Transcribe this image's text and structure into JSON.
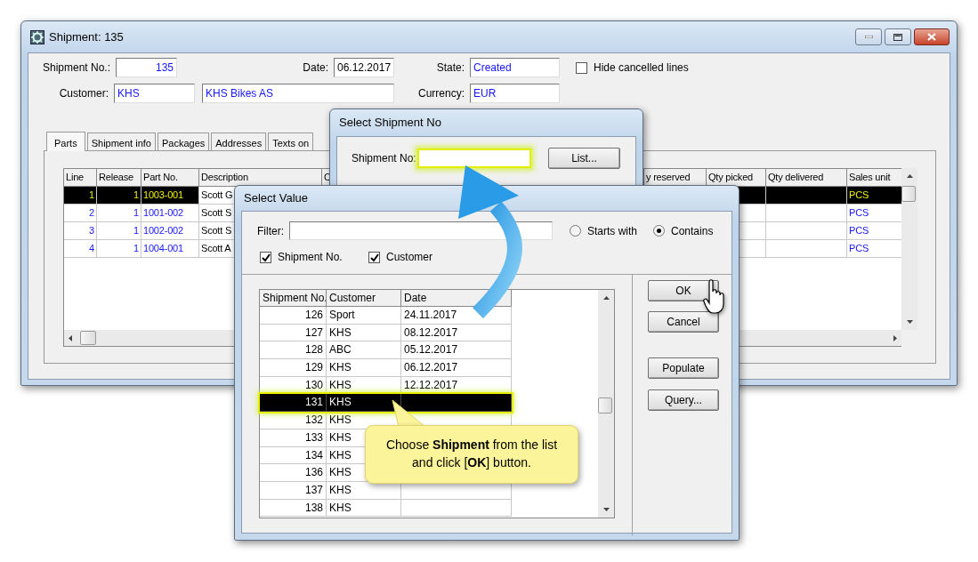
{
  "main_window": {
    "title": "Shipment: 135",
    "header": {
      "shipment_no": {
        "label": "Shipment No.:",
        "value": "135"
      },
      "date": {
        "label": "Date:",
        "value": "06.12.2017"
      },
      "state": {
        "label": "State:",
        "value": "Created"
      },
      "hide_cancelled": {
        "label": "Hide cancelled lines",
        "checked": false
      },
      "customer": {
        "label": "Customer:",
        "code": "KHS",
        "name": "KHS Bikes AS"
      },
      "currency": {
        "label": "Currency:",
        "value": "EUR"
      }
    },
    "tabs": [
      {
        "label": "Parts",
        "selected": true
      },
      {
        "label": "Shipment info",
        "selected": false
      },
      {
        "label": "Packages",
        "selected": false
      },
      {
        "label": "Addresses",
        "selected": false
      },
      {
        "label": "Texts on",
        "selected": false
      }
    ],
    "table": {
      "columns": [
        "Line",
        "Release",
        "Part No.",
        "Description",
        "C",
        "y reserved",
        "Qty picked",
        "Qty delivered",
        "Sales unit"
      ],
      "rows": [
        {
          "line": "1",
          "release": "1",
          "part_no": "1003-001",
          "description": "Scott G",
          "sales_unit": "PCS",
          "selected": true
        },
        {
          "line": "2",
          "release": "1",
          "part_no": "1001-002",
          "description": "Scott S",
          "sales_unit": "PCS",
          "selected": false
        },
        {
          "line": "3",
          "release": "1",
          "part_no": "1002-002",
          "description": "Scott S",
          "sales_unit": "PCS",
          "selected": false
        },
        {
          "line": "4",
          "release": "1",
          "part_no": "1004-001",
          "description": "Scott A",
          "sales_unit": "PCS",
          "selected": false
        }
      ]
    }
  },
  "shipment_dialog": {
    "title": "Select Shipment No",
    "field_label": "Shipment No:",
    "list_button": "List..."
  },
  "select_dialog": {
    "title": "Select Value",
    "filter_label": "Filter:",
    "match_options": [
      {
        "label": "Starts with",
        "selected": false
      },
      {
        "label": "Contains",
        "selected": true
      }
    ],
    "search_in": [
      {
        "label": "Shipment No.",
        "checked": true
      },
      {
        "label": "Customer",
        "checked": true
      }
    ],
    "list": {
      "columns": [
        "Shipment No.",
        "Customer",
        "Date"
      ],
      "rows": [
        {
          "shipment_no": "126",
          "customer": "Sport",
          "date": "24.11.2017",
          "selected": false
        },
        {
          "shipment_no": "127",
          "customer": "KHS",
          "date": "08.12.2017",
          "selected": false
        },
        {
          "shipment_no": "128",
          "customer": "ABC",
          "date": "05.12.2017",
          "selected": false
        },
        {
          "shipment_no": "129",
          "customer": "KHS",
          "date": "06.12.2017",
          "selected": false
        },
        {
          "shipment_no": "130",
          "customer": "KHS",
          "date": "12.12.2017",
          "selected": false
        },
        {
          "shipment_no": "131",
          "customer": "KHS",
          "selected": true
        },
        {
          "shipment_no": "132",
          "customer": "KHS",
          "selected": false
        },
        {
          "shipment_no": "133",
          "customer": "KHS",
          "selected": false
        },
        {
          "shipment_no": "134",
          "customer": "KHS",
          "selected": false
        },
        {
          "shipment_no": "136",
          "customer": "KHS",
          "selected": false
        },
        {
          "shipment_no": "137",
          "customer": "KHS",
          "selected": false
        },
        {
          "shipment_no": "138",
          "customer": "KHS",
          "selected": false
        }
      ]
    },
    "buttons": [
      "OK",
      "Cancel",
      "Populate",
      "Query..."
    ]
  },
  "callout": "Choose **Shipment** from the list and click [**OK**] button."
}
